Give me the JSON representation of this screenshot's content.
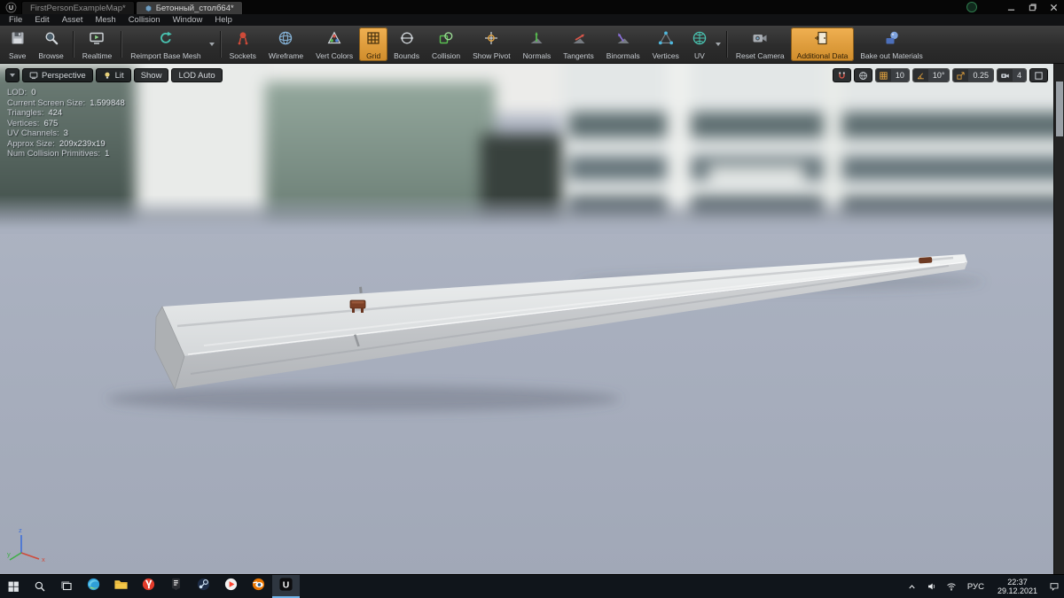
{
  "titlebar": {
    "tabs": [
      {
        "label": "FirstPersonExampleMap*"
      },
      {
        "label": "Бетонный_столб64*"
      }
    ]
  },
  "menu": {
    "items": [
      "File",
      "Edit",
      "Asset",
      "Mesh",
      "Collision",
      "Window",
      "Help"
    ]
  },
  "toolbar": {
    "groups": [
      {
        "buttons": [
          {
            "label": "Save",
            "icon": "save"
          },
          {
            "label": "Browse",
            "icon": "browse"
          }
        ]
      },
      {
        "buttons": [
          {
            "label": "Realtime",
            "icon": "realtime"
          }
        ]
      },
      {
        "buttons": [
          {
            "label": "Reimport Base Mesh",
            "icon": "reimport",
            "dropdown": true
          }
        ]
      },
      {
        "buttons": [
          {
            "label": "Sockets",
            "icon": "sockets"
          },
          {
            "label": "Wireframe",
            "icon": "wireframe"
          },
          {
            "label": "Vert Colors",
            "icon": "vert-colors"
          },
          {
            "label": "Grid",
            "icon": "grid",
            "active": true
          },
          {
            "label": "Bounds",
            "icon": "bounds"
          },
          {
            "label": "Collision",
            "icon": "collision"
          },
          {
            "label": "Show Pivot",
            "icon": "show-pivot"
          },
          {
            "label": "Normals",
            "icon": "normals"
          },
          {
            "label": "Tangents",
            "icon": "tangents"
          },
          {
            "label": "Binormals",
            "icon": "binormals"
          },
          {
            "label": "Vertices",
            "icon": "vertices"
          },
          {
            "label": "UV",
            "icon": "uv",
            "dropdown": true
          }
        ]
      },
      {
        "buttons": [
          {
            "label": "Reset Camera",
            "icon": "reset-camera"
          },
          {
            "label": "Additional Data",
            "icon": "additional-data",
            "active": true
          },
          {
            "label": "Bake out Materials",
            "icon": "bake-materials"
          }
        ]
      }
    ]
  },
  "viewport": {
    "controls": {
      "perspective": "Perspective",
      "lit": "Lit",
      "show": "Show",
      "lod": "LOD Auto"
    },
    "snaps": {
      "grid": "10",
      "angle": "10°",
      "scale": "0.25",
      "speed": "4"
    },
    "stats": [
      {
        "label": "LOD:",
        "value": "0"
      },
      {
        "label": "Current Screen Size:",
        "value": "1.599848"
      },
      {
        "label": "Triangles:",
        "value": "424"
      },
      {
        "label": "Vertices:",
        "value": "675"
      },
      {
        "label": "UV Channels:",
        "value": "3"
      },
      {
        "label": "Approx Size:",
        "value": "209x239x19"
      },
      {
        "label": "Num Collision Primitives:",
        "value": "1"
      }
    ]
  },
  "taskbar": {
    "apps": [
      {
        "icon": "edge"
      },
      {
        "icon": "file-explorer"
      },
      {
        "icon": "yandex-browser"
      },
      {
        "icon": "epic-games"
      },
      {
        "icon": "steam"
      },
      {
        "icon": "media-player"
      },
      {
        "icon": "blender"
      },
      {
        "icon": "unreal",
        "active": true
      }
    ],
    "lang": "РУС",
    "time": "22:37",
    "date": "29.12.2021"
  },
  "colors": {
    "accent_orange": "#d99836",
    "viewport_bg": "#a9b0bf"
  }
}
